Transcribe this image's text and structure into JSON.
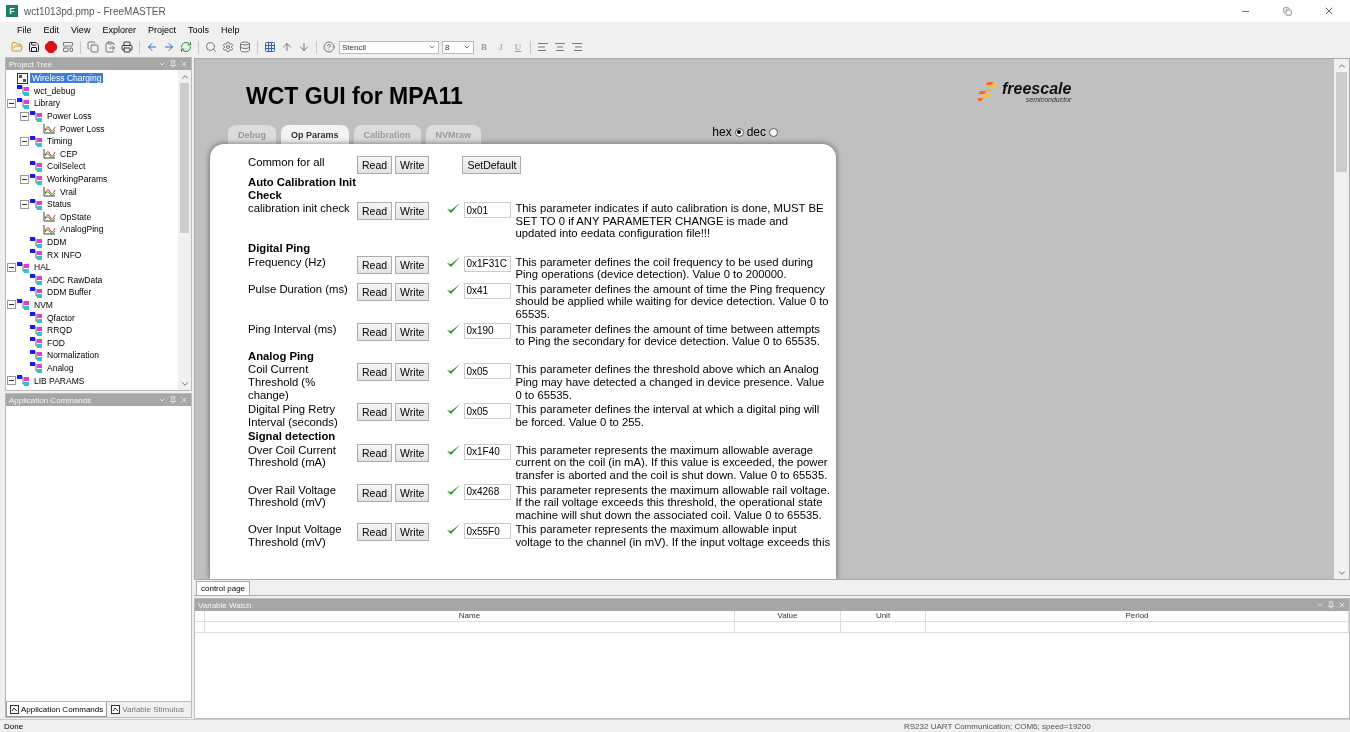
{
  "window": {
    "title": "wct1013pd.pmp - FreeMASTER",
    "app_icon_letter": "F"
  },
  "menu": [
    "File",
    "Edit",
    "View",
    "Explorer",
    "Project",
    "Tools",
    "Help"
  ],
  "toolbar": {
    "font": "Stencil",
    "size": "8",
    "styles": [
      "B",
      "I",
      "U"
    ]
  },
  "project_tree": {
    "title": "Project Tree",
    "items": [
      {
        "label": "Wireless Charging",
        "kind": "project",
        "selected": true
      },
      {
        "label": "wct_debug",
        "kind": "node",
        "selected": false
      },
      {
        "label": "Library",
        "kind": "node",
        "selected": false,
        "expanded": true,
        "children": [
          {
            "label": "Power Loss",
            "kind": "node",
            "selected": false,
            "expanded": true,
            "children": [
              {
                "label": "Power Loss",
                "kind": "scope",
                "selected": false
              }
            ]
          },
          {
            "label": "Timing",
            "kind": "node",
            "selected": false,
            "expanded": true,
            "children": [
              {
                "label": "CEP",
                "kind": "scope",
                "selected": false
              }
            ]
          },
          {
            "label": "CoilSelect",
            "kind": "node",
            "selected": false
          },
          {
            "label": "WorkingParams",
            "kind": "node",
            "selected": false,
            "expanded": true,
            "children": [
              {
                "label": "Vrail",
                "kind": "scope",
                "selected": false
              }
            ]
          },
          {
            "label": "Status",
            "kind": "node",
            "selected": false,
            "expanded": true,
            "children": [
              {
                "label": "OpState",
                "kind": "scope",
                "selected": false
              },
              {
                "label": "AnalogPing",
                "kind": "scope",
                "selected": false
              }
            ]
          },
          {
            "label": "DDM",
            "kind": "node",
            "selected": false
          },
          {
            "label": "RX INFO",
            "kind": "node",
            "selected": false
          }
        ]
      },
      {
        "label": "HAL",
        "kind": "node",
        "selected": false,
        "expanded": true,
        "children": [
          {
            "label": "ADC RawData",
            "kind": "node",
            "selected": false
          },
          {
            "label": "DDM Buffer",
            "kind": "node",
            "selected": false
          }
        ]
      },
      {
        "label": "NVM",
        "kind": "node",
        "selected": false,
        "expanded": true,
        "children": [
          {
            "label": "Qfactor",
            "kind": "node",
            "selected": false
          },
          {
            "label": "RRQD",
            "kind": "node",
            "selected": false
          },
          {
            "label": "FOD",
            "kind": "node",
            "selected": false
          },
          {
            "label": "Normalization",
            "kind": "node",
            "selected": false
          },
          {
            "label": "Analog",
            "kind": "node",
            "selected": false
          }
        ]
      },
      {
        "label": "LIB PARAMS",
        "kind": "node",
        "selected": false,
        "expanded": true
      }
    ]
  },
  "app_commands": {
    "title": "Application Commands",
    "tabs": [
      {
        "label": "Application Commands",
        "selected": true
      },
      {
        "label": "Variable Stimulus",
        "selected": false
      }
    ]
  },
  "web": {
    "title": "WCT GUI for MPA11",
    "logo": {
      "name": "freescale",
      "tagline": "semiconductor"
    },
    "tabs": [
      {
        "label": "Debug",
        "selected": false
      },
      {
        "label": "Op Params",
        "selected": true
      },
      {
        "label": "Calibration",
        "selected": false
      },
      {
        "label": "NVMraw",
        "selected": false
      }
    ],
    "radix": [
      {
        "label": "hex",
        "selected": true
      },
      {
        "label": "dec",
        "selected": false
      }
    ],
    "rows": [
      {
        "kind": "common",
        "label": "Common for all",
        "read": "Read",
        "write": "Write",
        "extra": "SetDefault"
      },
      {
        "kind": "heading",
        "label": "Auto Calibration Init Check"
      },
      {
        "kind": "param",
        "label": "calibration init check",
        "read": "Read",
        "write": "Write",
        "verified": true,
        "value": "0x01",
        "description": "This parameter indicates if auto calibration is done, MUST BE SET TO 0 if ANY PARAMETER CHANGE is made and updated into eedata configuration file!!!"
      },
      {
        "kind": "heading",
        "label": "Digital Ping"
      },
      {
        "kind": "param",
        "label": "Frequency (Hz)",
        "read": "Read",
        "write": "Write",
        "verified": true,
        "value": "0x1F31C",
        "description": "This parameter defines the coil frequency to be used during Ping operations (device detection). Value 0 to 200000."
      },
      {
        "kind": "param",
        "label": "Pulse Duration (ms)",
        "read": "Read",
        "write": "Write",
        "verified": true,
        "value": "0x41",
        "description": "This parameter defines the amount of time the Ping frequency should be applied while waiting for device detection. Value 0 to 65535."
      },
      {
        "kind": "param",
        "label": "Ping Interval (ms)",
        "read": "Read",
        "write": "Write",
        "verified": true,
        "value": "0x190",
        "description": "This parameter defines the amount of time between attempts to Ping the secondary for device detection. Value 0 to 65535."
      },
      {
        "kind": "heading",
        "label": "Analog Ping"
      },
      {
        "kind": "param",
        "label": "Coil Current Threshold (% change)",
        "read": "Read",
        "write": "Write",
        "verified": true,
        "value": "0x05",
        "description": "This parameter defines the threshold above which an Analog Ping may have detected a changed in device presence. Value 0 to 65535."
      },
      {
        "kind": "param",
        "label": "Digital Ping Retry Interval (seconds)",
        "read": "Read",
        "write": "Write",
        "verified": true,
        "value": "0x05",
        "description": "This parameter defines the interval at which a digital ping will be forced. Value 0 to 255."
      },
      {
        "kind": "heading",
        "label": "Signal detection"
      },
      {
        "kind": "param",
        "label": "Over Coil Current Threshold (mA)",
        "read": "Read",
        "write": "Write",
        "verified": true,
        "value": "0x1F40",
        "description": "This parameter represents the maximum allowable average current on the coil (in mA). If this value is exceeded, the power transfer is aborted and the coil is shut down. Value 0 to 65535."
      },
      {
        "kind": "param",
        "label": "Over Rail Voltage Threshold (mV)",
        "read": "Read",
        "write": "Write",
        "verified": true,
        "value": "0x4268",
        "description": "This parameter represents the maximum allowable rail voltage. If the rail voltage exceeds this threshold, the operational state machine will shut down the associated coil. Value 0 to 65535."
      },
      {
        "kind": "param",
        "label": "Over Input Voltage Threshold (mV)",
        "read": "Read",
        "write": "Write",
        "verified": true,
        "value": "0x55F0",
        "description": "This parameter represents the maximum allowable input voltage to the channel (in mV). If the input voltage exceeds this"
      }
    ]
  },
  "doc_tabs": [
    {
      "label": "control page",
      "selected": true
    }
  ],
  "variable_watch": {
    "title": "Variable Watch",
    "columns": [
      "Name",
      "Value",
      "Unit",
      "Period"
    ]
  },
  "status_bar": {
    "left": "Done",
    "right": "RS232 UART Communication; COM6; speed=19200"
  }
}
